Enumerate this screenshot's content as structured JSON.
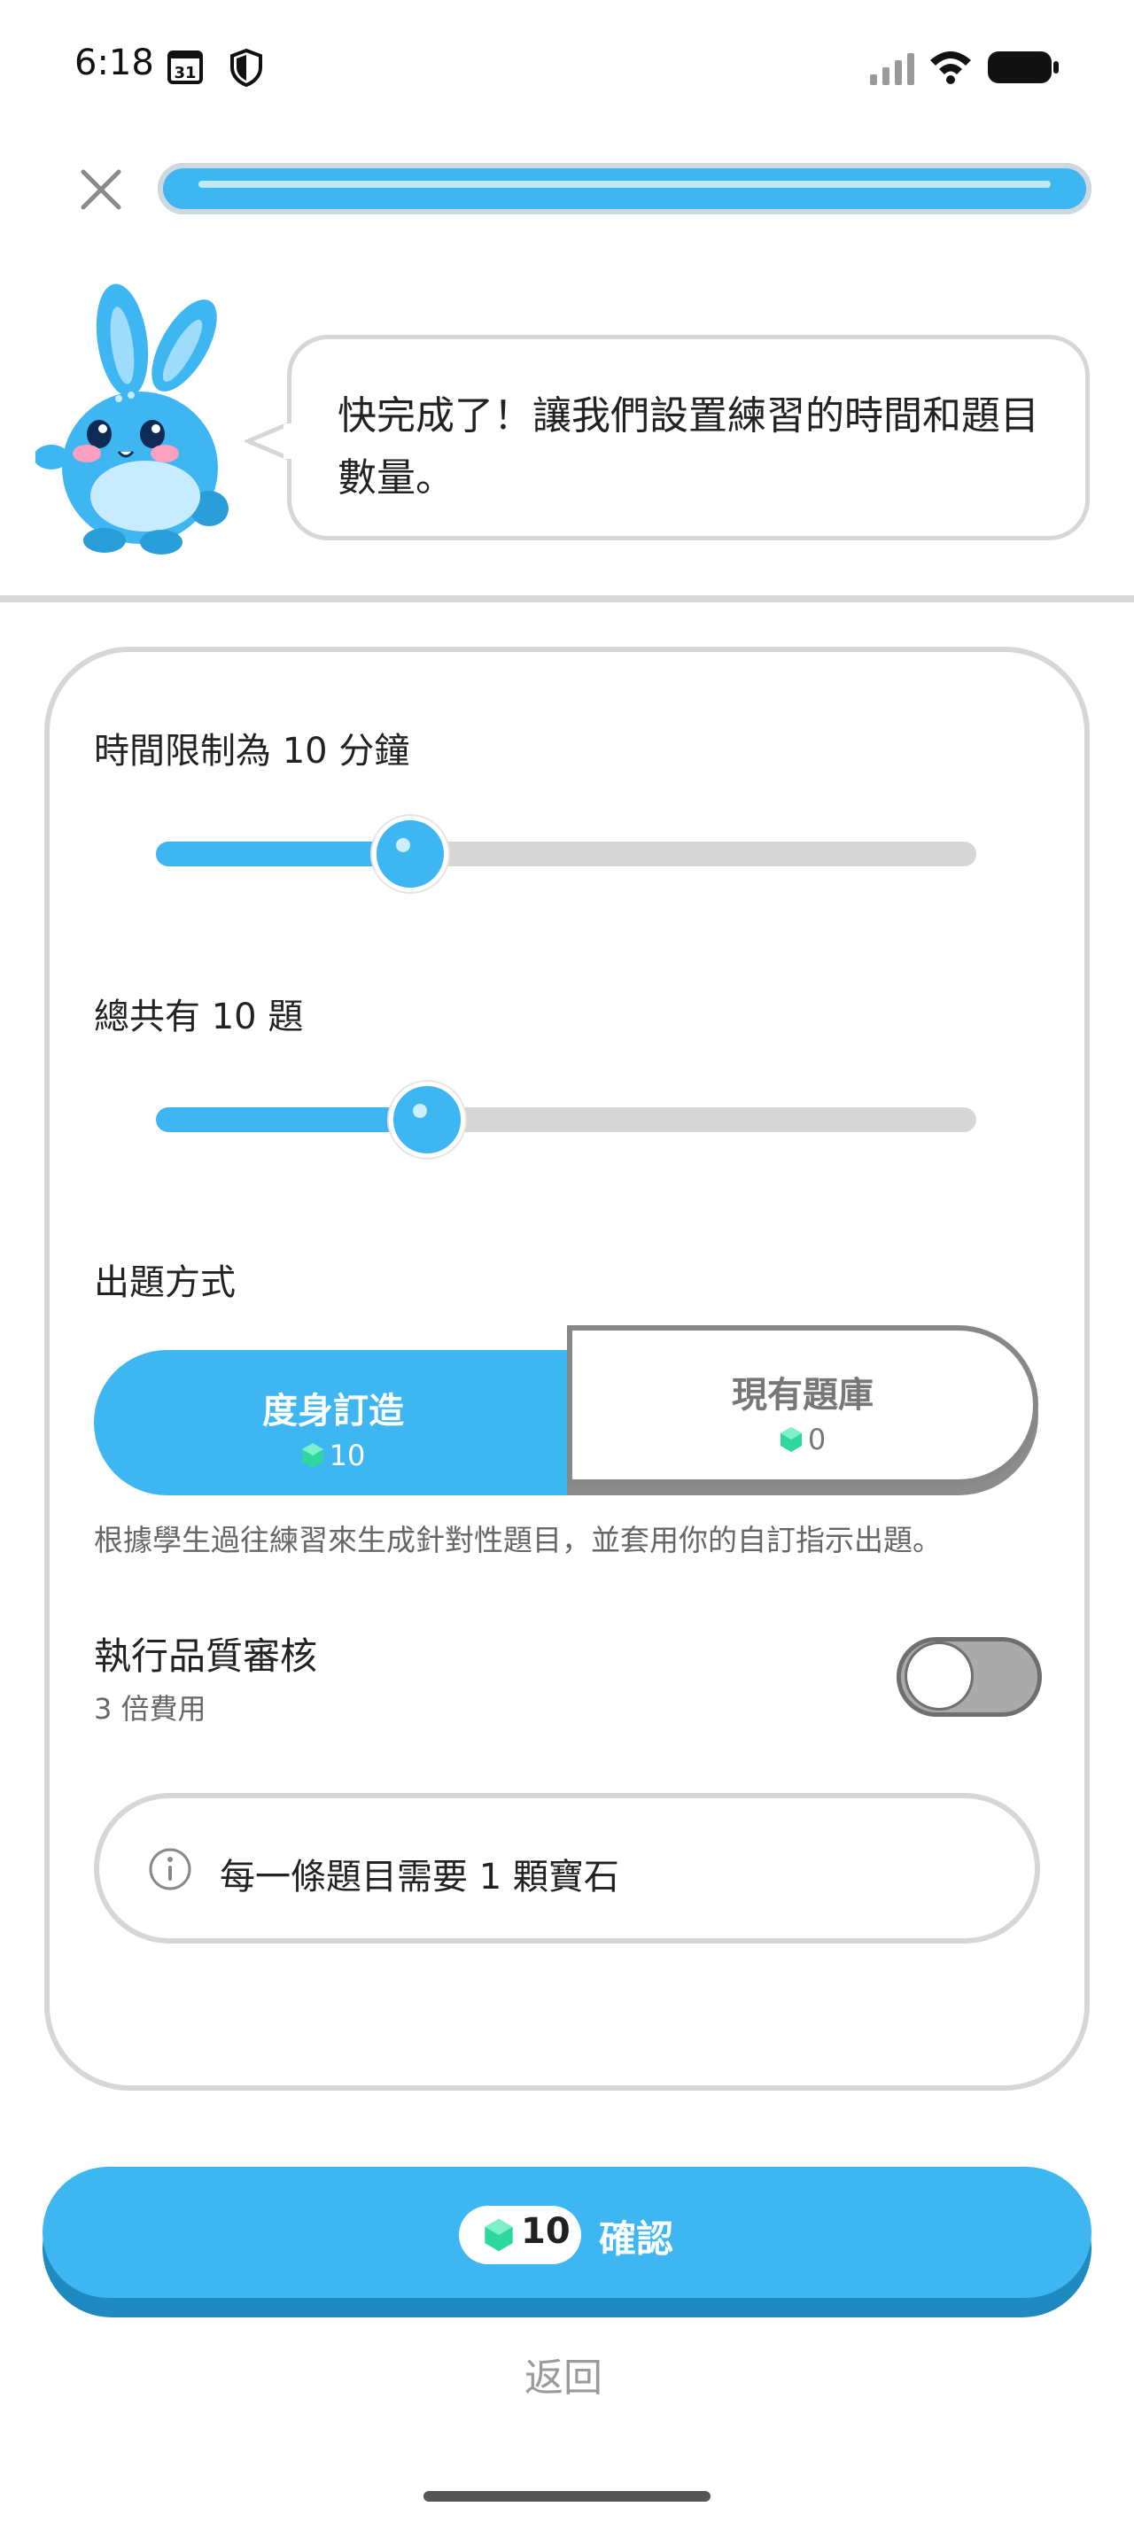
{
  "status_bar": {
    "time": "6:18",
    "calendar_day": "31",
    "icons": [
      "calendar-icon",
      "shield-icon",
      "signal-icon",
      "wifi-icon",
      "battery-icon"
    ]
  },
  "header": {
    "close_icon": "close-icon",
    "progress_fraction": 1.0
  },
  "mascot": {
    "message": "快完成了！讓我們設置練習的時間和題目數量。"
  },
  "settings": {
    "time_limit": {
      "label": "時間限制為 10 分鐘",
      "value_fraction": 0.31
    },
    "question_count": {
      "label": "總共有 10 題",
      "value_fraction": 0.33
    },
    "mode": {
      "label": "出題方式",
      "options": [
        {
          "title": "度身訂造",
          "cost": "10",
          "selected": true
        },
        {
          "title": "現有題庫",
          "cost": "0",
          "selected": false
        }
      ],
      "description": "根據學生過往練習來生成針對性題目，並套用你的自訂指示出題。"
    },
    "quality_check": {
      "label": "執行品質審核",
      "sublabel": "3 倍費用",
      "enabled": false
    },
    "info": "每一條題目需要 1 顆寶石"
  },
  "footer": {
    "confirm_cost": "10",
    "confirm_label": "確認",
    "back_label": "返回"
  },
  "colors": {
    "accent": "#3db6f2",
    "accent_dark": "#1f8ac0",
    "gem": "#2ed6a0",
    "track": "#d6d6d6"
  }
}
